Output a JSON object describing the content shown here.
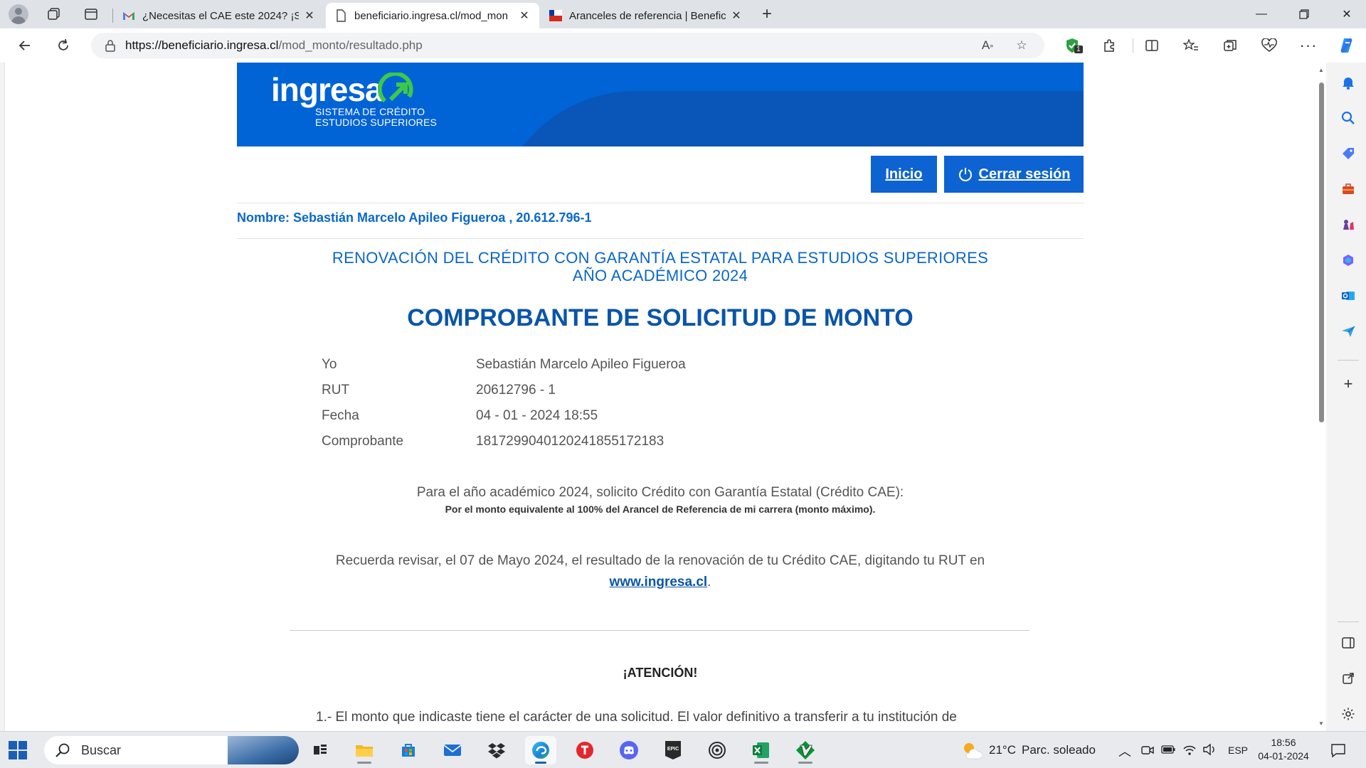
{
  "browser": {
    "tabs": [
      {
        "title": "¿Necesitas el CAE este 2024? ¡Sol",
        "favicon": "gmail-icon"
      },
      {
        "title": "beneficiario.ingresa.cl/mod_mon",
        "favicon": "page-icon"
      },
      {
        "title": "Aranceles de referencia | Benefic",
        "favicon": "chile-flag-icon"
      }
    ],
    "url_domain": "https://beneficiario.ingresa.cl",
    "url_path": "/mod_monto/resultado.php",
    "extension_badge": "1"
  },
  "page": {
    "logo_word": "ingresa",
    "logo_sub1": "SISTEMA DE CRÉDITO",
    "logo_sub2": "ESTUDIOS SUPERIORES",
    "btn_inicio": "Inicio",
    "btn_cerrar": "Cerrar sesión",
    "name_line": "Nombre: Sebastián Marcelo Apileo Figueroa , 20.612.796-1",
    "title_line1": "RENOVACIÓN DEL CRÉDITO CON GARANTÍA ESTATAL PARA ESTUDIOS SUPERIORES",
    "title_line2": "AÑO ACADÉMICO 2024",
    "big_title": "COMPROBANTE DE SOLICITUD DE MONTO",
    "rows": [
      {
        "label": "Yo",
        "value": "Sebastián Marcelo Apileo Figueroa"
      },
      {
        "label": "RUT",
        "value": "20612796 - 1"
      },
      {
        "label": "Fecha",
        "value": "04 - 01 - 2024 18:55"
      },
      {
        "label": "Comprobante",
        "value": "18172990401202418551721​83"
      }
    ],
    "solicito": "Para el año académico 2024, solicito Crédito con Garantía Estatal (Crédito CAE):",
    "monto": "Por el monto equivalente al 100% del Arancel de Referencia de mi carrera (monto máximo).",
    "recuerda": "Recuerda revisar, el 07 de Mayo 2024, el resultado de la renovación de tu Crédito CAE, digitando tu RUT en",
    "link": "www.ingresa.cl",
    "link_suffix": ".",
    "attention": "¡ATENCIÓN!",
    "item1": "1.- El monto que indicaste tiene el carácter de una solicitud. El valor definitivo a transferir a tu institución de"
  },
  "taskbar": {
    "search_placeholder": "Buscar",
    "weather": "21°C",
    "weather_desc": "Parc. soleado",
    "lang": "ESP",
    "time": "18:56",
    "date": "04-01-2024"
  },
  "colors": {
    "brand_blue": "#0063d6",
    "title_blue": "#0a67c7",
    "dark_blue": "#0a55a8"
  }
}
